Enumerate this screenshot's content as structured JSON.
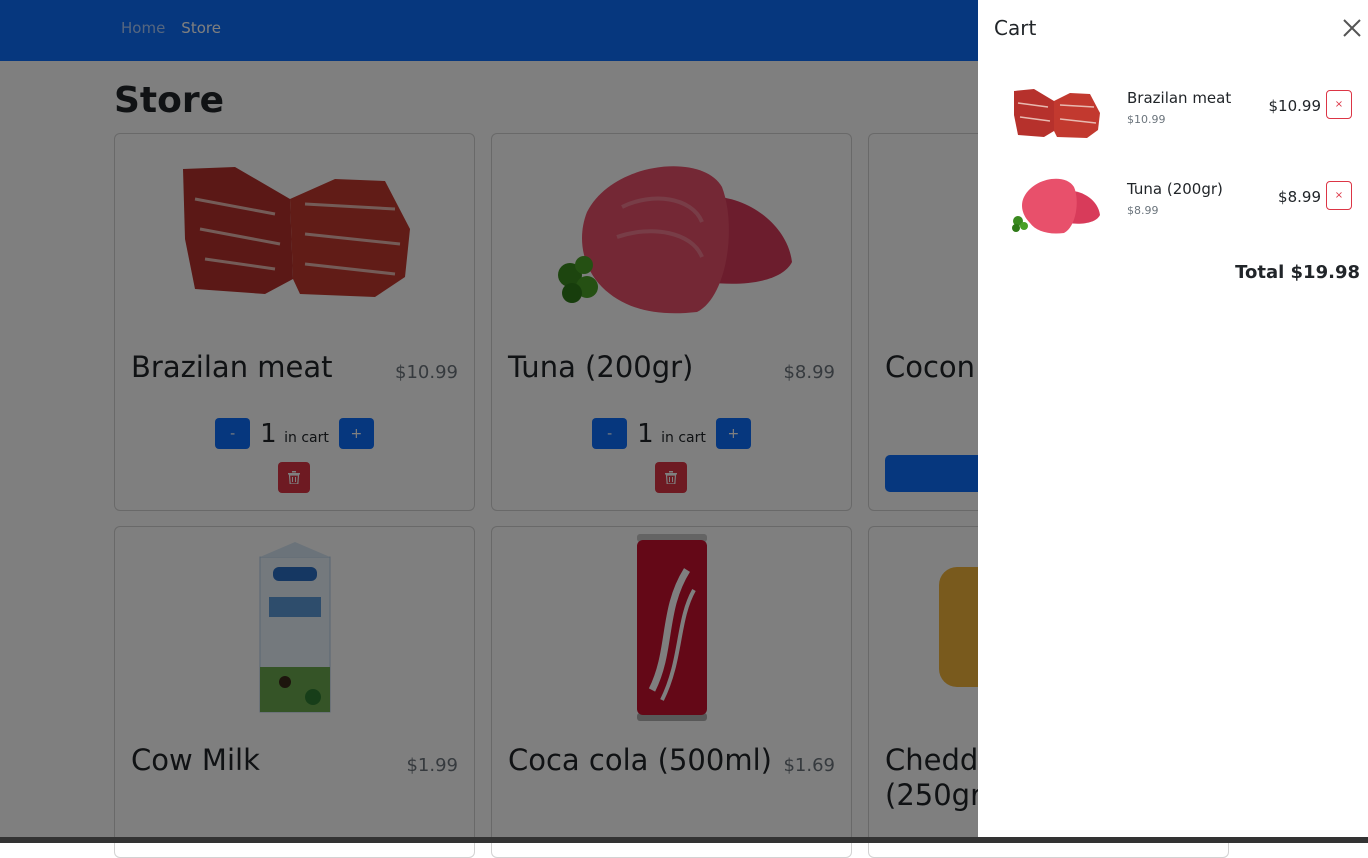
{
  "nav": {
    "home": "Home",
    "store": "Store"
  },
  "page": {
    "title": "Store"
  },
  "products": [
    {
      "name": "Brazilan meat",
      "price": "$10.99",
      "qty": "1",
      "in_cart": "in cart",
      "minus": "-",
      "plus": "+"
    },
    {
      "name": "Tuna (200gr)",
      "price": "$8.99",
      "qty": "1",
      "in_cart": "in cart",
      "minus": "-",
      "plus": "+"
    },
    {
      "name": "Cocon"
    },
    {
      "name": "Cow Milk",
      "price": "$1.99"
    },
    {
      "name": "Coca cola (500ml)",
      "price": "$1.69"
    },
    {
      "name": "Chedd (250gr"
    }
  ],
  "cart": {
    "title": "Cart",
    "items": [
      {
        "name": "Brazilan meat",
        "unit_price": "$10.99",
        "total": "$10.99",
        "remove": "×"
      },
      {
        "name": "Tuna (200gr)",
        "unit_price": "$8.99",
        "total": "$8.99",
        "remove": "×"
      }
    ],
    "total": "Total $19.98"
  },
  "colors": {
    "primary": "#0d6efd",
    "danger": "#dc3545",
    "backdrop": "rgba(0,0,0,0.5)"
  },
  "icons": {
    "trash": "trash-icon",
    "close": "close-icon"
  }
}
